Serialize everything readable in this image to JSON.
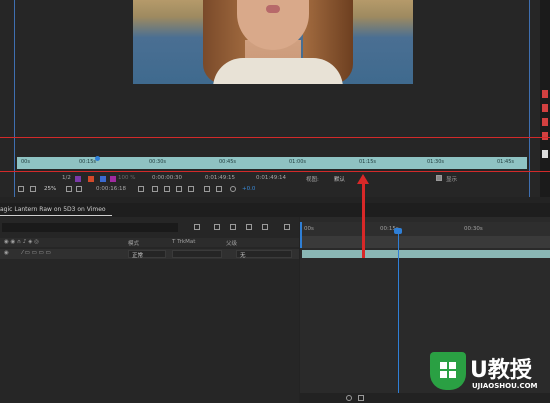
{
  "mini_timeline": {
    "labels": [
      "00s",
      "00:15s",
      "00:30s",
      "00:45s",
      "01:00s",
      "01:15s",
      "01:30s",
      "01:45s"
    ]
  },
  "viewer_toolbar": {
    "row1": {
      "fps_hint": "1/2",
      "zoom_text": "100 %",
      "timecode_start": "0:00:00:30",
      "timecode_end": "0:01:49:15",
      "timecode_duration": "0:01:49:14",
      "view_label": "视图:",
      "view_value": "默认",
      "checkbox_label": "显示"
    },
    "row2": {
      "zoom": "25%",
      "current_time": "0:00:16:18",
      "exposure": "+0.0"
    }
  },
  "timeline": {
    "tab_title": "agic Lantern Raw on 5D3 on Vimeo",
    "columns": {
      "mode": "模式",
      "trkmat": "T TrkMat",
      "parent": "父级"
    },
    "layer": {
      "mode_value": "正常",
      "parent_value": "无"
    },
    "ruler": {
      "labels": [
        "00s",
        "00:15s",
        "00:30s"
      ]
    }
  },
  "watermark": {
    "brand": "U教授",
    "url": "UJIAOSHOU.COM"
  },
  "colors": {
    "annotation_red": "#d82828",
    "playhead_blue": "#2f7fd6",
    "timeline_bar": "#8ab7b5",
    "watermark_green": "#2aa043"
  }
}
